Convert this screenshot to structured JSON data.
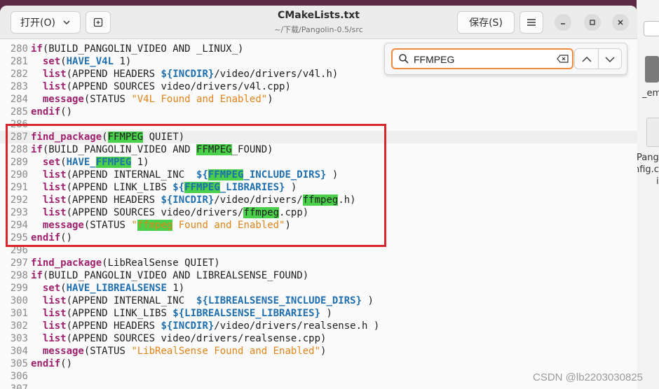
{
  "window": {
    "title": "CMakeLists.txt",
    "subtitle": "~/下载/Pangolin-0.5/src",
    "open_label": "打开(O)",
    "save_label": "保存(S)"
  },
  "search": {
    "query": "FFMPEG"
  },
  "background": {
    "text1": "_em",
    "text2": "Pango",
    "text3": "nfig.c",
    "text4": "i"
  },
  "watermark": "CSDN @lb2203030825",
  "colors": {
    "keyword": "#a0226e",
    "variable": "#1f6fae",
    "string": "#e08418",
    "match": "#4ad04a",
    "highlight_box": "#d9262e",
    "search_focus": "#f08a3c"
  },
  "lines": [
    {
      "n": "280",
      "t": [
        [
          "k",
          "if"
        ],
        [
          "",
          "(BUILD_PANGOLIN_VIDEO AND _LINUX_)"
        ]
      ]
    },
    {
      "n": "281",
      "t": [
        [
          "",
          "  "
        ],
        [
          "k",
          "set"
        ],
        [
          "",
          "("
        ],
        [
          "v",
          "HAVE_V4L"
        ],
        [
          "",
          " 1)"
        ]
      ]
    },
    {
      "n": "282",
      "t": [
        [
          "",
          "  "
        ],
        [
          "k",
          "list"
        ],
        [
          "",
          "(APPEND HEADERS "
        ],
        [
          "v",
          "${INCDIR}"
        ],
        [
          "",
          "/video/drivers/v4l.h)"
        ]
      ]
    },
    {
      "n": "283",
      "t": [
        [
          "",
          "  "
        ],
        [
          "k",
          "list"
        ],
        [
          "",
          "(APPEND SOURCES video/drivers/v4l.cpp)"
        ]
      ]
    },
    {
      "n": "284",
      "t": [
        [
          "",
          "  "
        ],
        [
          "k",
          "message"
        ],
        [
          "",
          "(STATUS "
        ],
        [
          "s",
          "\"V4L Found and Enabled\""
        ],
        [
          "",
          ")"
        ]
      ]
    },
    {
      "n": "285",
      "t": [
        [
          "k",
          "endif"
        ],
        [
          "",
          "()"
        ]
      ]
    },
    {
      "n": "286",
      "t": []
    },
    {
      "n": "287",
      "cur": true,
      "t": [
        [
          "k",
          "find_package"
        ],
        [
          "",
          "("
        ],
        [
          "m",
          "FFMPEG"
        ],
        [
          "",
          " QUIET)"
        ]
      ]
    },
    {
      "n": "288",
      "t": [
        [
          "k",
          "if"
        ],
        [
          "",
          "(BUILD_PANGOLIN_VIDEO AND "
        ],
        [
          "m",
          "FFMPEG"
        ],
        [
          "",
          "_FOUND)"
        ]
      ]
    },
    {
      "n": "289",
      "t": [
        [
          "",
          "  "
        ],
        [
          "k",
          "set"
        ],
        [
          "",
          "("
        ],
        [
          "v",
          "HAVE_"
        ],
        [
          "vm",
          "FFMPEG"
        ],
        [
          "",
          " 1)"
        ]
      ]
    },
    {
      "n": "290",
      "t": [
        [
          "",
          "  "
        ],
        [
          "k",
          "list"
        ],
        [
          "",
          "(APPEND INTERNAL_INC  "
        ],
        [
          "v",
          "${"
        ],
        [
          "vm",
          "FFMPEG"
        ],
        [
          "v",
          "_INCLUDE_DIRS}"
        ],
        [
          "",
          " )"
        ]
      ]
    },
    {
      "n": "291",
      "t": [
        [
          "",
          "  "
        ],
        [
          "k",
          "list"
        ],
        [
          "",
          "(APPEND LINK_LIBS "
        ],
        [
          "v",
          "${"
        ],
        [
          "vm",
          "FFMPEG"
        ],
        [
          "v",
          "_LIBRARIES}"
        ],
        [
          "",
          " )"
        ]
      ]
    },
    {
      "n": "292",
      "t": [
        [
          "",
          "  "
        ],
        [
          "k",
          "list"
        ],
        [
          "",
          "(APPEND HEADERS "
        ],
        [
          "v",
          "${INCDIR}"
        ],
        [
          "",
          "/video/drivers/"
        ],
        [
          "m",
          "ffmpeg"
        ],
        [
          "",
          ".h)"
        ]
      ]
    },
    {
      "n": "293",
      "t": [
        [
          "",
          "  "
        ],
        [
          "k",
          "list"
        ],
        [
          "",
          "(APPEND SOURCES video/drivers/"
        ],
        [
          "m",
          "ffmpeg"
        ],
        [
          "",
          ".cpp)"
        ]
      ]
    },
    {
      "n": "294",
      "t": [
        [
          "",
          "  "
        ],
        [
          "k",
          "message"
        ],
        [
          "",
          "(STATUS "
        ],
        [
          "s",
          "\""
        ],
        [
          "sm",
          "ffmpeg"
        ],
        [
          "s",
          " Found and Enabled\""
        ],
        [
          "",
          ")"
        ]
      ]
    },
    {
      "n": "295",
      "t": [
        [
          "k",
          "endif"
        ],
        [
          "",
          "()"
        ]
      ]
    },
    {
      "n": "296",
      "t": []
    },
    {
      "n": "297",
      "t": [
        [
          "k",
          "find_package"
        ],
        [
          "",
          "(LibRealSense QUIET)"
        ]
      ]
    },
    {
      "n": "298",
      "t": [
        [
          "k",
          "if"
        ],
        [
          "",
          "(BUILD_PANGOLIN_VIDEO AND LIBREALSENSE_FOUND)"
        ]
      ]
    },
    {
      "n": "299",
      "t": [
        [
          "",
          "  "
        ],
        [
          "k",
          "set"
        ],
        [
          "",
          "("
        ],
        [
          "v",
          "HAVE_LIBREALSENSE"
        ],
        [
          "",
          " 1)"
        ]
      ]
    },
    {
      "n": "300",
      "t": [
        [
          "",
          "  "
        ],
        [
          "k",
          "list"
        ],
        [
          "",
          "(APPEND INTERNAL_INC  "
        ],
        [
          "v",
          "${LIBREALSENSE_INCLUDE_DIRS}"
        ],
        [
          "",
          " )"
        ]
      ]
    },
    {
      "n": "301",
      "t": [
        [
          "",
          "  "
        ],
        [
          "k",
          "list"
        ],
        [
          "",
          "(APPEND LINK_LIBS "
        ],
        [
          "v",
          "${LIBREALSENSE_LIBRARIES}"
        ],
        [
          "",
          " )"
        ]
      ]
    },
    {
      "n": "302",
      "t": [
        [
          "",
          "  "
        ],
        [
          "k",
          "list"
        ],
        [
          "",
          "(APPEND HEADERS "
        ],
        [
          "v",
          "${INCDIR}"
        ],
        [
          "",
          "/video/drivers/realsense.h )"
        ]
      ]
    },
    {
      "n": "303",
      "t": [
        [
          "",
          "  "
        ],
        [
          "k",
          "list"
        ],
        [
          "",
          "(APPEND SOURCES video/drivers/realsense.cpp)"
        ]
      ]
    },
    {
      "n": "304",
      "t": [
        [
          "",
          "  "
        ],
        [
          "k",
          "message"
        ],
        [
          "",
          "(STATUS "
        ],
        [
          "s",
          "\"LibRealSense Found and Enabled\""
        ],
        [
          "",
          ")"
        ]
      ]
    },
    {
      "n": "305",
      "t": [
        [
          "k",
          "endif"
        ],
        [
          "",
          "()"
        ]
      ]
    },
    {
      "n": "306",
      "t": []
    },
    {
      "n": "307",
      "t": []
    }
  ]
}
